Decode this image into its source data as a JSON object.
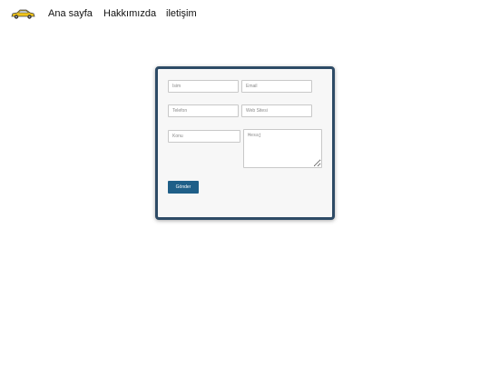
{
  "nav": {
    "logo_icon": "car-icon",
    "links": [
      "Ana sayfa",
      "Hakkımızda",
      "iletişim"
    ]
  },
  "form": {
    "name_placeholder": "İsim",
    "email_placeholder": "Email",
    "phone_placeholder": "Telefon",
    "website_placeholder": "Web Sitesi",
    "subject_placeholder": "Konu",
    "message_placeholder": "Mesaj",
    "submit_label": "Gönder"
  },
  "colors": {
    "card_border": "#2e4b66",
    "button": "#1f5f88",
    "card_background": "#f7f7f7"
  }
}
